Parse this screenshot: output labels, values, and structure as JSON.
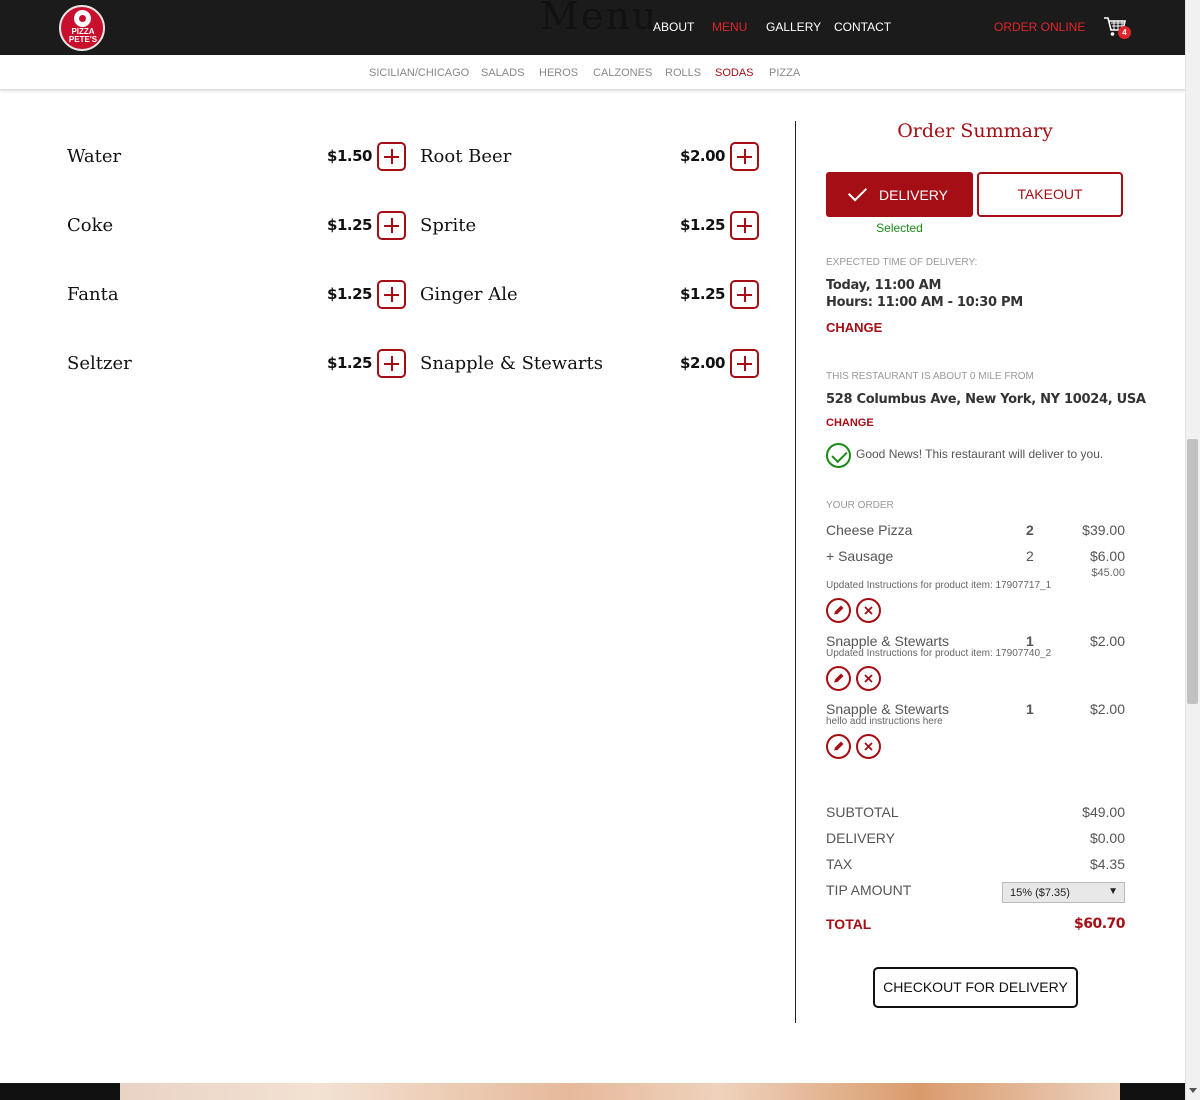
{
  "header": {
    "logo_text": "PIZZA PETE'S",
    "page_title": "Menu",
    "nav": [
      "ABOUT",
      "MENU",
      "GALLERY",
      "CONTACT"
    ],
    "nav_active": "MENU",
    "order_online": "ORDER ONLINE",
    "cart_count": "4"
  },
  "categories": {
    "items": [
      "SICILIAN/CHICAGO",
      "SALADS",
      "HEROS",
      "CALZONES",
      "ROLLS",
      "SODAS",
      "PIZZA"
    ],
    "active": "SODAS"
  },
  "menu_items": [
    {
      "name": "Water",
      "price": "$1.50"
    },
    {
      "name": "Root Beer",
      "price": "$2.00"
    },
    {
      "name": "Coke",
      "price": "$1.25"
    },
    {
      "name": "Sprite",
      "price": "$1.25"
    },
    {
      "name": "Fanta",
      "price": "$1.25"
    },
    {
      "name": "Ginger Ale",
      "price": "$1.25"
    },
    {
      "name": "Seltzer",
      "price": "$1.25"
    },
    {
      "name": "Snapple & Stewarts",
      "price": "$2.00"
    }
  ],
  "summary": {
    "title": "Order Summary",
    "delivery_label": "DELIVERY",
    "takeout_label": "TAKEOUT",
    "selected_label": "Selected",
    "expected_time_label": "EXPECTED TIME OF DELIVERY:",
    "expected_time_value": "Today, 11:00 AM",
    "hours": "Hours: 11:00 AM - 10:30 PM",
    "change_time": "CHANGE",
    "distance_label": "THIS RESTAURANT IS ABOUT 0 MILE FROM",
    "address": "528 Columbus Ave, New York, NY 10024, USA",
    "change_address": "CHANGE",
    "good_news": "Good News! This restaurant will deliver to you.",
    "your_order_label": "YOUR ORDER",
    "order": {
      "cheese_pizza": {
        "name": "Cheese Pizza",
        "qty": "2",
        "price": "$39.00"
      },
      "sausage": {
        "name": "+ Sausage",
        "qty": "2",
        "price": "$6.00"
      },
      "pizza_line_total": "$45.00",
      "pizza_note": "Updated Instructions for product item: 17907717_1",
      "snapple_1": {
        "name": "Snapple & Stewarts",
        "qty": "1",
        "price": "$2.00",
        "note": "Updated Instructions for product item: 17907740_2"
      },
      "snapple_2": {
        "name": "Snapple & Stewarts",
        "qty": "1",
        "price": "$2.00",
        "note": "hello add instructions here"
      }
    },
    "subtotal_label": "SUBTOTAL",
    "subtotal": "$49.00",
    "delivery_fee_label": "DELIVERY",
    "delivery_fee": "$0.00",
    "tax_label": "TAX",
    "tax": "$4.35",
    "tip_label": "TIP AMOUNT",
    "tip_selected": "15% ($7.35)",
    "total_label": "TOTAL",
    "total": "$60.70",
    "checkout_label": "CHECKOUT FOR DELIVERY"
  },
  "colors": {
    "brand_red": "#a50e14",
    "nav_red": "#e0262b",
    "success_green": "#1a8a1a",
    "header_bg": "#1b1b1b"
  }
}
